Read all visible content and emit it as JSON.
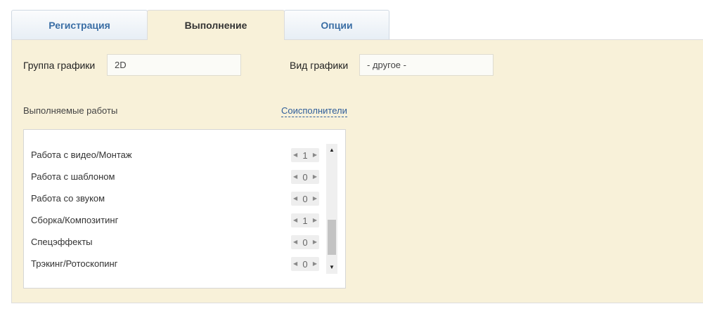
{
  "tabs": [
    {
      "label": "Регистрация",
      "active": false
    },
    {
      "label": "Выполнение",
      "active": true
    },
    {
      "label": "Опции",
      "active": false
    }
  ],
  "form": {
    "graphics_group_label": "Группа графики",
    "graphics_group_value": "2D",
    "graphics_type_label": "Вид графики",
    "graphics_type_value": "- другое -",
    "works_label": "Выполняемые работы",
    "coexecutors_link": "Соисполнители"
  },
  "works": [
    {
      "name": "Работа с видео/Монтаж",
      "count": "1"
    },
    {
      "name": "Работа с шаблоном",
      "count": "0"
    },
    {
      "name": "Работа со звуком",
      "count": "0"
    },
    {
      "name": "Сборка/Композитинг",
      "count": "1"
    },
    {
      "name": "Спецэффекты",
      "count": "0"
    },
    {
      "name": "Трэкинг/Ротоскопинг",
      "count": "0"
    }
  ],
  "icons": {
    "stepper_left": "triangle-left-icon",
    "stepper_right": "triangle-right-icon",
    "scroll_up": "triangle-up-icon",
    "scroll_down": "triangle-down-icon"
  },
  "colors": {
    "panel_bg": "#f8f1d9",
    "tab_text": "#3a6ea5",
    "link": "#2f5e9a"
  }
}
